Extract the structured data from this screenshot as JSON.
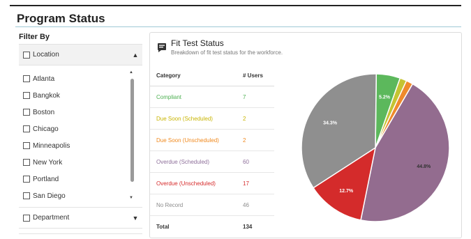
{
  "page": {
    "title": "Program Status"
  },
  "filter": {
    "title": "Filter By",
    "location_label": "Location",
    "locations": [
      "Atlanta",
      "Bangkok",
      "Boston",
      "Chicago",
      "Minneapolis",
      "New York",
      "Portland",
      "San Diego"
    ],
    "department_label": "Department"
  },
  "card": {
    "title": "Fit Test Status",
    "subtitle": "Breakdown of fit test status for the workforce.",
    "columns": [
      "Category",
      "# Users"
    ],
    "rows": [
      {
        "category": "Compliant",
        "users": "7",
        "color": "#4caf50"
      },
      {
        "category": "Due Soon (Scheduled)",
        "users": "2",
        "color": "#c8b400"
      },
      {
        "category": "Due Soon (Unscheduled)",
        "users": "2",
        "color": "#f0891e"
      },
      {
        "category": "Overdue (Scheduled)",
        "users": "60",
        "color": "#8e6f9a"
      },
      {
        "category": "Overdue (Unscheduled)",
        "users": "17",
        "color": "#d62b2b"
      },
      {
        "category": "No Record",
        "users": "46",
        "color": "#8c8c8c"
      }
    ],
    "total_label": "Total",
    "total_value": "134"
  },
  "chart_data": {
    "type": "pie",
    "categories": [
      "Compliant",
      "Due Soon (Scheduled)",
      "Due Soon (Unscheduled)",
      "Overdue (Scheduled)",
      "Overdue (Unscheduled)",
      "No Record"
    ],
    "values": [
      7,
      2,
      2,
      60,
      17,
      46
    ],
    "colors": [
      "#5cb85c",
      "#c4c432",
      "#ef8a2c",
      "#936c8f",
      "#d42b2b",
      "#8f8f8f"
    ],
    "data_labels": [
      "5.2%",
      "",
      "",
      "44.8%",
      "12.7%",
      "34.3%"
    ],
    "label_colors": [
      "#ffffff",
      "#ffffff",
      "#ffffff",
      "#333333",
      "#ffffff",
      "#ffffff"
    ]
  }
}
